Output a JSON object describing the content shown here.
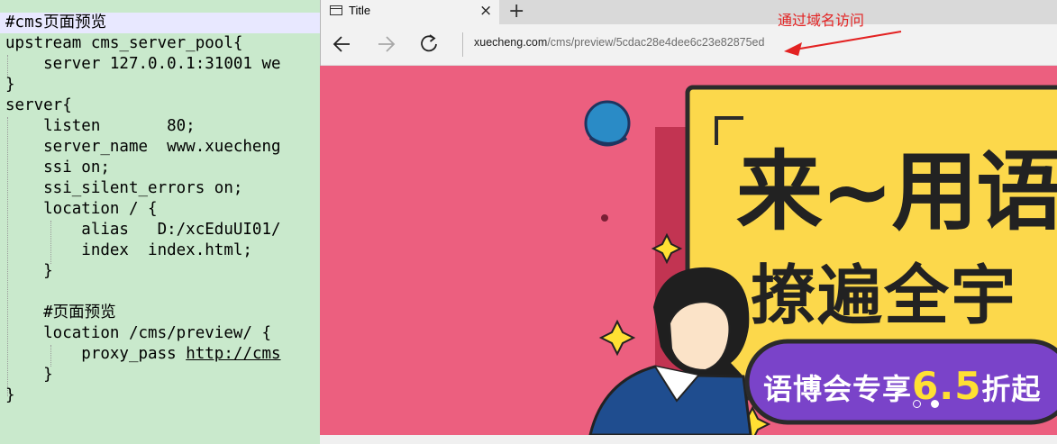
{
  "editor": {
    "lines": [
      "#cms页面预览",
      "upstream cms_server_pool{",
      "    server 127.0.0.1:31001 we",
      "}",
      "server{",
      "    listen       80;",
      "    server_name  www.xuecheng",
      "    ssi on;",
      "    ssi_silent_errors on;",
      "    location / {",
      "        alias   D:/xcEduUI01/",
      "        index  index.html;",
      "    }",
      "",
      "    #页面预览",
      "    location /cms/preview/ {",
      "        proxy_pass ",
      "    }",
      "}"
    ],
    "proxy_url": "http://cms"
  },
  "browser": {
    "tab_title": "Title",
    "tab_close": "×",
    "new_tab": "+",
    "address_host": "xuecheng.com",
    "address_path": "/cms/preview/5cdac28e4dee6c23e82875ed"
  },
  "annotation": {
    "text": "通过域名访问",
    "color": "#e32222"
  },
  "banner": {
    "headline1": "来~用语",
    "headline2": "撩遍全宇",
    "promo_prefix": "语博会专享",
    "promo_number": "6.5",
    "promo_suffix": "折起",
    "background": "#ec5f7f",
    "panel_color": "#fcd84b",
    "accent": "#ffe033"
  },
  "icons": {
    "tab": "page-icon",
    "close": "close-icon",
    "new_tab": "plus-icon",
    "back": "arrow-left-icon",
    "forward": "arrow-right-icon",
    "refresh": "refresh-icon"
  }
}
